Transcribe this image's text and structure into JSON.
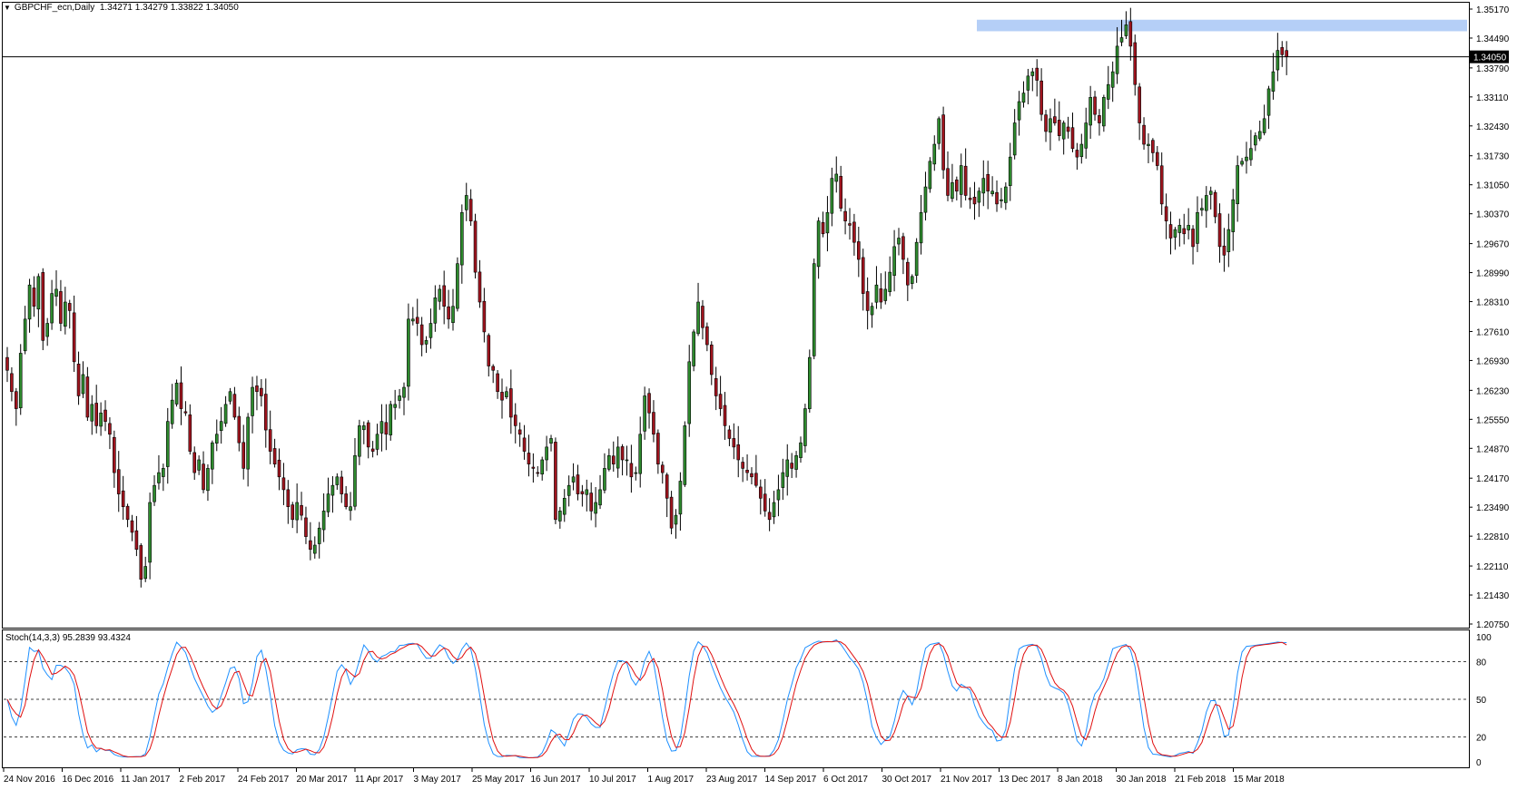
{
  "header": {
    "symbol": "GBPCHF_ecn,Daily",
    "ohlc": "1.34271 1.34279 1.33822 1.34050"
  },
  "indicator": {
    "label": "Stoch(14,3,3) 95.2839 93.4324",
    "levels": [
      "100",
      "80",
      "50",
      "20",
      "0"
    ]
  },
  "price_axis": {
    "ticks": [
      "1.35170",
      "1.34490",
      "1.33790",
      "1.33110",
      "1.32430",
      "1.31730",
      "1.31050",
      "1.30370",
      "1.29670",
      "1.28990",
      "1.28310",
      "1.27610",
      "1.26930",
      "1.26230",
      "1.25550",
      "1.24870",
      "1.24170",
      "1.23490",
      "1.22810",
      "1.22110",
      "1.21430",
      "1.20750"
    ],
    "current_price": "1.34050"
  },
  "time_axis": {
    "ticks": [
      "24 Nov 2016",
      "16 Dec 2016",
      "11 Jan 2017",
      "2 Feb 2017",
      "24 Feb 2017",
      "20 Mar 2017",
      "11 Apr 2017",
      "3 May 2017",
      "25 May 2017",
      "16 Jun 2017",
      "10 Jul 2017",
      "1 Aug 2017",
      "23 Aug 2017",
      "14 Sep 2017",
      "6 Oct 2017",
      "30 Oct 2017",
      "21 Nov 2017",
      "13 Dec 2017",
      "8 Jan 2018",
      "30 Jan 2018",
      "21 Feb 2018",
      "15 Mar 2018"
    ]
  },
  "colors": {
    "bull": "#2e8b2e",
    "bear": "#a0141e",
    "wick": "#000000",
    "zone": "#b5cff7",
    "stoch_main": "#1e90ff",
    "stoch_signal": "#e01010"
  },
  "chart_data": {
    "type": "candlestick",
    "title": "GBPCHF_ecn,Daily",
    "ylim": [
      1.2075,
      1.3517
    ],
    "current_price": 1.3405,
    "resistance_zone": [
      1.3465,
      1.3492
    ],
    "closes": [
      1.267,
      1.262,
      1.258,
      1.271,
      1.279,
      1.287,
      1.282,
      1.289,
      1.274,
      1.278,
      1.285,
      1.286,
      1.278,
      1.283,
      1.281,
      1.269,
      1.261,
      1.266,
      1.256,
      1.259,
      1.254,
      1.257,
      1.255,
      1.252,
      1.243,
      1.238,
      1.235,
      1.232,
      1.229,
      1.225,
      1.218,
      1.221,
      1.236,
      1.24,
      1.243,
      1.244,
      1.255,
      1.26,
      1.264,
      1.258,
      1.257,
      1.248,
      1.243,
      1.246,
      1.239,
      1.244,
      1.25,
      1.252,
      1.255,
      1.259,
      1.262,
      1.256,
      1.25,
      1.244,
      1.256,
      1.263,
      1.262,
      1.261,
      1.253,
      1.248,
      1.245,
      1.242,
      1.239,
      1.235,
      1.232,
      1.236,
      1.233,
      1.228,
      1.225,
      1.226,
      1.23,
      1.234,
      1.238,
      1.24,
      1.242,
      1.238,
      1.235,
      1.235,
      1.247,
      1.254,
      1.254,
      1.249,
      1.248,
      1.252,
      1.255,
      1.252,
      1.259,
      1.259,
      1.261,
      1.263,
      1.279,
      1.279,
      1.278,
      1.273,
      1.274,
      1.278,
      1.284,
      1.286,
      1.282,
      1.279,
      1.282,
      1.292,
      1.304,
      1.308,
      1.302,
      1.29,
      1.283,
      1.276,
      1.268,
      1.267,
      1.262,
      1.26,
      1.262,
      1.256,
      1.254,
      1.252,
      1.248,
      1.245,
      1.244,
      1.243,
      1.246,
      1.249,
      1.251,
      1.232,
      1.234,
      1.237,
      1.24,
      1.242,
      1.238,
      1.238,
      1.239,
      1.234,
      1.236,
      1.239,
      1.244,
      1.247,
      1.245,
      1.249,
      1.246,
      1.246,
      1.242,
      1.243,
      1.252,
      1.261,
      1.257,
      1.252,
      1.245,
      1.243,
      1.237,
      1.23,
      1.233,
      1.241,
      1.254,
      1.269,
      1.276,
      1.283,
      1.277,
      1.273,
      1.266,
      1.261,
      1.258,
      1.254,
      1.251,
      1.249,
      1.246,
      1.244,
      1.243,
      1.242,
      1.24,
      1.237,
      1.234,
      1.232,
      1.236,
      1.239,
      1.243,
      1.246,
      1.244,
      1.247,
      1.25,
      1.258,
      1.27,
      1.292,
      1.302,
      1.299,
      1.304,
      1.312,
      1.313,
      1.305,
      1.302,
      1.301,
      1.297,
      1.293,
      1.285,
      1.281,
      1.282,
      1.287,
      1.283,
      1.286,
      1.29,
      1.296,
      1.298,
      1.293,
      1.287,
      1.289,
      1.297,
      1.304,
      1.31,
      1.316,
      1.32,
      1.326,
      1.314,
      1.308,
      1.311,
      1.309,
      1.315,
      1.308,
      1.307,
      1.306,
      1.309,
      1.312,
      1.309,
      1.309,
      1.306,
      1.307,
      1.31,
      1.317,
      1.325,
      1.33,
      1.332,
      1.336,
      1.337,
      1.335,
      1.327,
      1.323,
      1.326,
      1.325,
      1.322,
      1.325,
      1.323,
      1.319,
      1.317,
      1.32,
      1.325,
      1.331,
      1.327,
      1.325,
      1.331,
      1.334,
      1.337,
      1.343,
      1.345,
      1.348,
      1.343,
      1.334,
      1.325,
      1.32,
      1.32,
      1.318,
      1.315,
      1.306,
      1.302,
      1.298,
      1.3,
      1.301,
      1.299,
      1.301,
      1.296,
      1.304,
      1.305,
      1.308,
      1.309,
      1.303,
      1.296,
      1.294,
      1.3,
      1.307,
      1.315,
      1.316,
      1.317,
      1.319,
      1.322,
      1.323,
      1.326,
      1.333,
      1.337,
      1.342,
      1.341,
      1.3405
    ],
    "stochastic": {
      "name": "Stoch(14,3,3)",
      "main_last": 95.2839,
      "signal_last": 93.4324,
      "levels": [
        80,
        50,
        20
      ],
      "ylim": [
        0,
        100
      ]
    }
  }
}
